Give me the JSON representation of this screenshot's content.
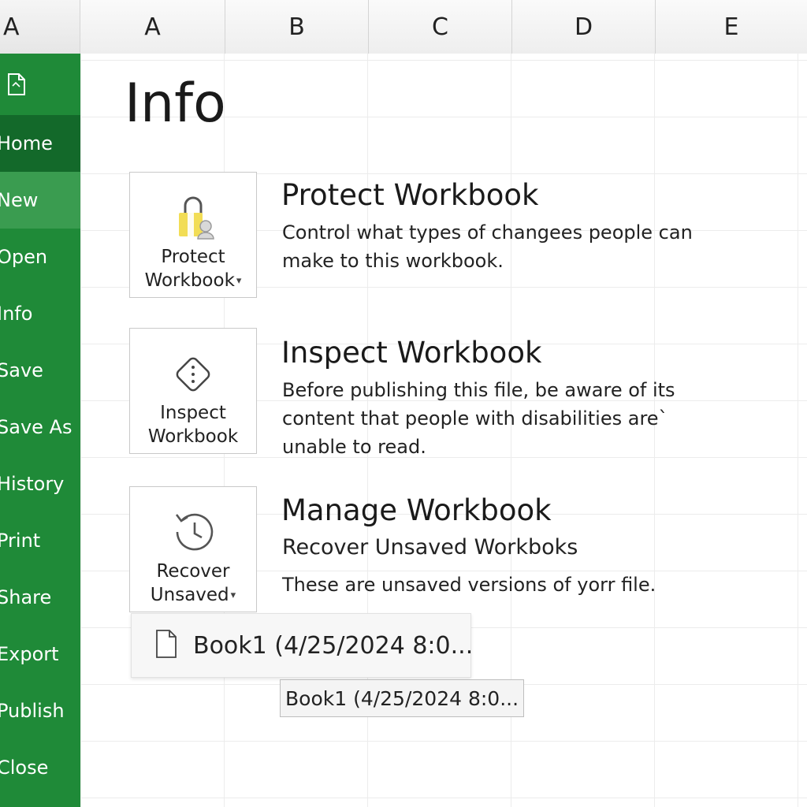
{
  "columns": {
    "corner": "A",
    "items": [
      "A",
      "B",
      "C",
      "D",
      "E"
    ]
  },
  "sidebar": {
    "file_icon": "file-icon",
    "items": [
      {
        "label": "Home",
        "state": "active"
      },
      {
        "label": "New",
        "state": "hover"
      },
      {
        "label": "Open",
        "state": ""
      },
      {
        "label": "Info",
        "state": ""
      },
      {
        "label": "Save",
        "state": ""
      },
      {
        "label": "Save As",
        "state": ""
      },
      {
        "label": "History",
        "state": ""
      },
      {
        "label": "Print",
        "state": ""
      },
      {
        "label": "Share",
        "state": ""
      },
      {
        "label": "Export",
        "state": ""
      },
      {
        "label": "Publish",
        "state": ""
      },
      {
        "label": "Close",
        "state": ""
      }
    ]
  },
  "main": {
    "title": "Info",
    "protect": {
      "button_line1": "Protect",
      "button_line2": "Workbook",
      "icon": "lock-icon",
      "title": "Protect Workbook",
      "desc_line1": "Control what types of changees people can",
      "desc_line2": "make to this workbook."
    },
    "inspect": {
      "button_line1": "Inspect",
      "button_line2": "Workbook",
      "icon": "inspect-diamond-icon",
      "title": "Inspect Workbook",
      "desc_line1": "Before publishing this file, be aware of its",
      "desc_line2": "content that people with disabilities are`",
      "desc_line3": "unable to read."
    },
    "manage": {
      "button_line1": "Recover",
      "button_line2": "Unsaved",
      "icon": "history-clock-icon",
      "title": "Manage Workbook",
      "subtitle": "Recover Unsaved Workboks",
      "desc": "These are unsaved versions of yorr file."
    },
    "dropdown": {
      "item": "Book1 (4/25/2024 8:0...",
      "icon": "document-icon"
    },
    "tooltip": "Book1 (4/25/2024 8:0..."
  },
  "colors": {
    "sidebar": "#1f8a38",
    "sidebar_active": "#13692a",
    "sidebar_hover": "#3a9c50",
    "lock_body": "#f2dd55"
  }
}
